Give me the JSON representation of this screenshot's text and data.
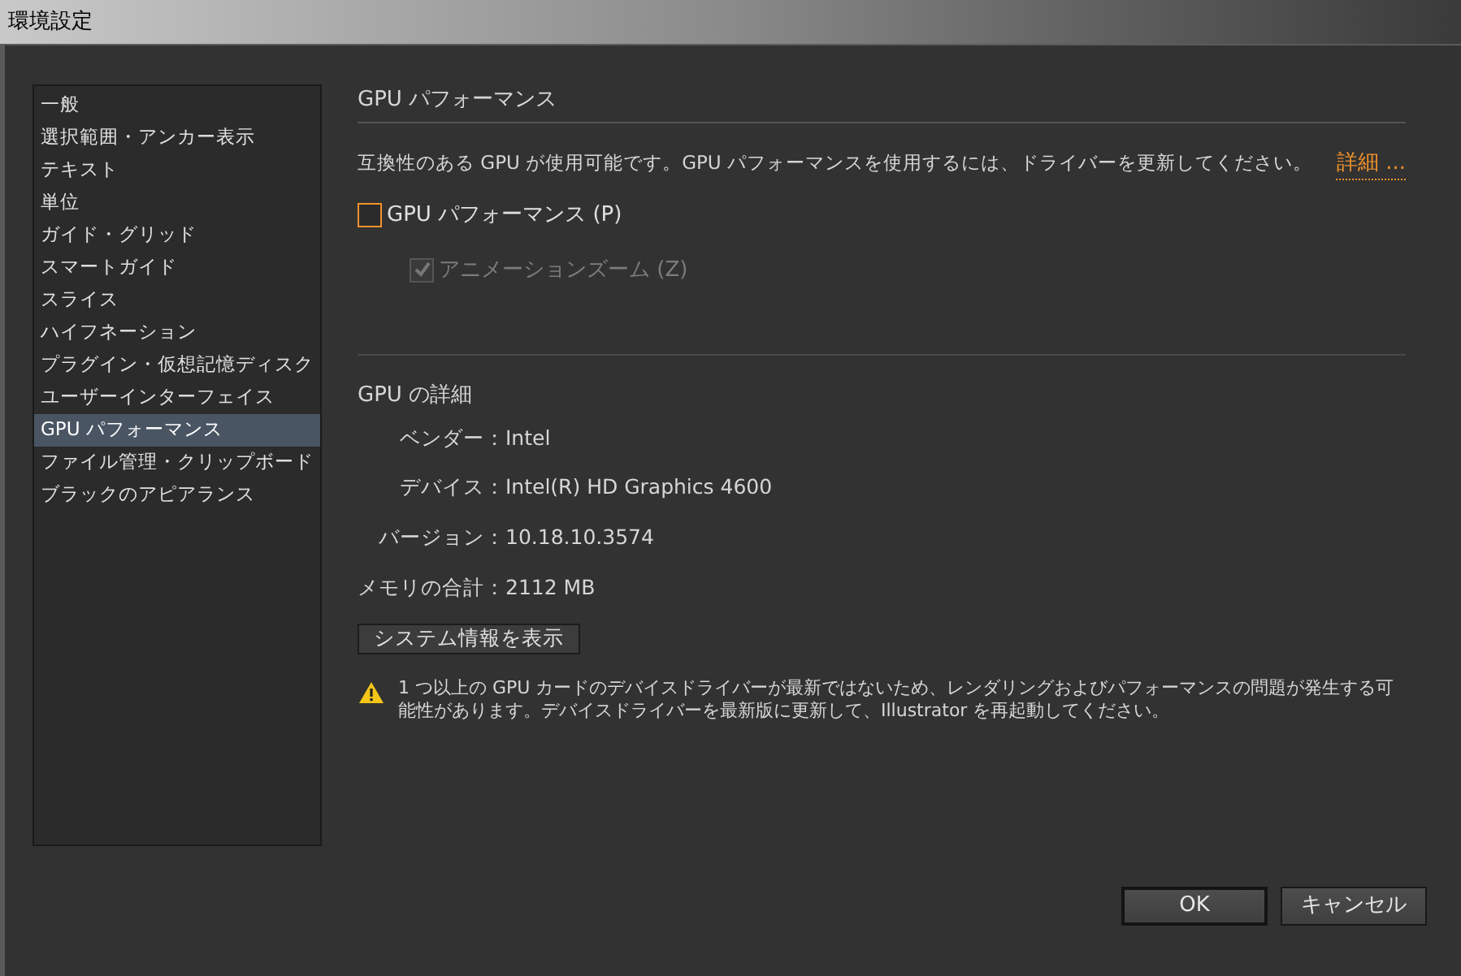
{
  "window": {
    "title": "環境設定"
  },
  "sidebar": {
    "items": [
      {
        "label": "一般",
        "selected": false
      },
      {
        "label": "選択範囲・アンカー表示",
        "selected": false
      },
      {
        "label": "テキスト",
        "selected": false
      },
      {
        "label": "単位",
        "selected": false
      },
      {
        "label": "ガイド・グリッド",
        "selected": false
      },
      {
        "label": "スマートガイド",
        "selected": false
      },
      {
        "label": "スライス",
        "selected": false
      },
      {
        "label": "ハイフネーション",
        "selected": false
      },
      {
        "label": "プラグイン・仮想記憶ディスク",
        "selected": false
      },
      {
        "label": "ユーザーインターフェイス",
        "selected": false
      },
      {
        "label": "GPU パフォーマンス",
        "selected": true
      },
      {
        "label": "ファイル管理・クリップボード",
        "selected": false
      },
      {
        "label": "ブラックのアピアランス",
        "selected": false
      }
    ]
  },
  "section_title": "GPU パフォーマンス",
  "notice": {
    "text": "互換性のある GPU が使用可能です。GPU パフォーマンスを使用するには、ドライバーを更新してください。",
    "link": "詳細 ..."
  },
  "options": [
    {
      "label": "GPU パフォーマンス (P)",
      "checked": false,
      "disabled": false,
      "focused": true
    },
    {
      "label": "アニメーションズーム (Z)",
      "checked": true,
      "disabled": true,
      "focused": false
    }
  ],
  "details": {
    "title": "GPU の詳細",
    "rows": [
      {
        "label": "ベンダー：",
        "value": "Intel"
      },
      {
        "label": "デバイス：",
        "value": "Intel(R) HD Graphics 4600"
      },
      {
        "label": "バージョン：",
        "value": "10.18.10.3574"
      },
      {
        "label": "メモリの合計：",
        "value": "2112 MB"
      }
    ]
  },
  "system_info_button": "システム情報を表示",
  "warning": "1 つ以上の GPU カードのデバイスドライバーが最新ではないため、レンダリングおよびパフォーマンスの問題が発生する可能性があります。デバイスドライバーを最新版に更新して、Illustrator を再起動してください。",
  "buttons": [
    {
      "label": "OK",
      "default": true
    },
    {
      "label": "キャンセル",
      "default": false
    }
  ]
}
